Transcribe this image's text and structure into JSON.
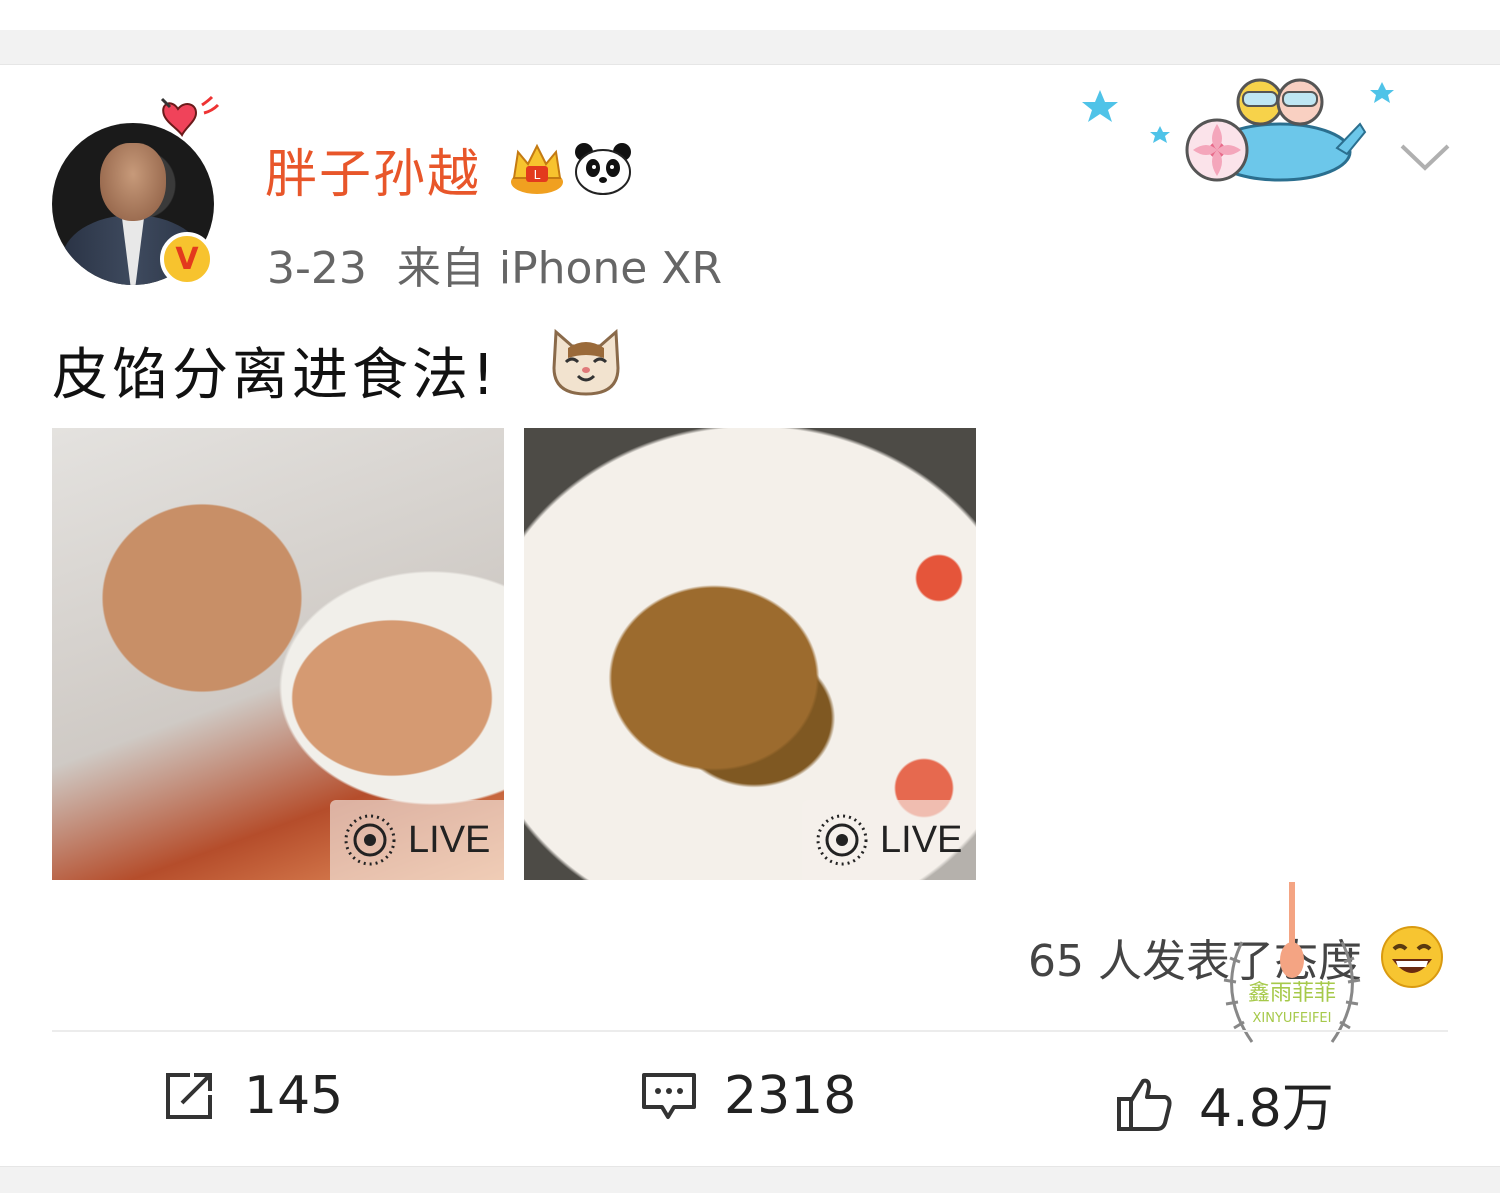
{
  "post": {
    "author": {
      "name": "胖子孙越",
      "verified_icon": "verified-v-badge",
      "badges": [
        "crown-icon",
        "panda-icon"
      ]
    },
    "meta": {
      "date": "3-23",
      "source": "来自 iPhone XR"
    },
    "text": "皮馅分离进食法!",
    "text_emoji": "cat-face-emoji",
    "images": [
      {
        "description_icon": "food-photo",
        "live_label": "LIVE"
      },
      {
        "description_icon": "food-photo",
        "live_label": "LIVE"
      }
    ],
    "reactions_text": "65 人发表了态度",
    "reaction_emoji": "grinning-face-emoji",
    "watermark": {
      "line1": "鑫雨菲菲",
      "line2": "XINYUFEIFEI"
    }
  },
  "actions": {
    "repost_count": "145",
    "comment_count": "2318",
    "like_count": "4.8万"
  },
  "colors": {
    "username": "#e8562a",
    "background_gap": "#f2f2f2",
    "verified_badge": "#f7c32e"
  }
}
